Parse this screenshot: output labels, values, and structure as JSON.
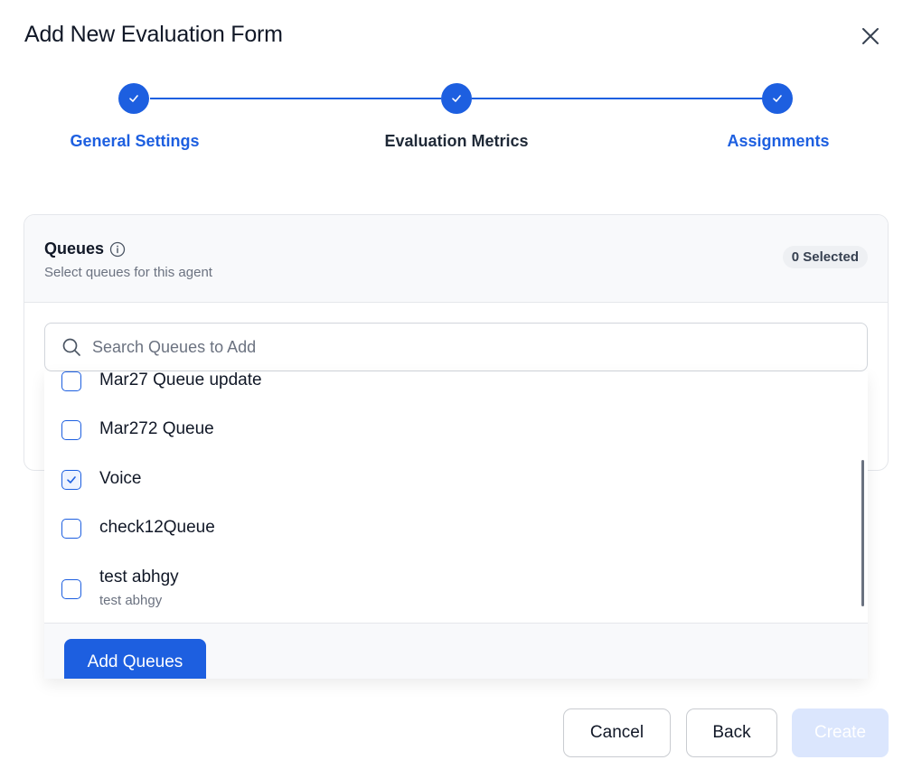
{
  "dialog": {
    "title": "Add New Evaluation Form"
  },
  "stepper": {
    "steps": [
      {
        "label": "General Settings",
        "state": "complete",
        "label_color": "#1d5fe0"
      },
      {
        "label": "Evaluation Metrics",
        "state": "complete",
        "label_color": "#1f2937"
      },
      {
        "label": "Assignments",
        "state": "complete",
        "label_color": "#1d5fe0"
      }
    ]
  },
  "queues": {
    "title": "Queues",
    "subtitle": "Select queues for this agent",
    "selected_badge": "0 Selected",
    "search_placeholder": "Search Queues to Add",
    "items": [
      {
        "label": "Mar27 Queue update",
        "checked": false
      },
      {
        "label": "Mar272 Queue",
        "checked": false
      },
      {
        "label": "Voice",
        "checked": true
      },
      {
        "label": "check12Queue",
        "checked": false
      },
      {
        "label": "test abhgy",
        "sub": "test abhgy",
        "checked": false
      }
    ],
    "add_button": "Add Queues"
  },
  "actions": {
    "cancel": "Cancel",
    "back": "Back",
    "create": "Create"
  },
  "colors": {
    "accent": "#1d5fe0",
    "disabled": "#dbe6fd"
  }
}
